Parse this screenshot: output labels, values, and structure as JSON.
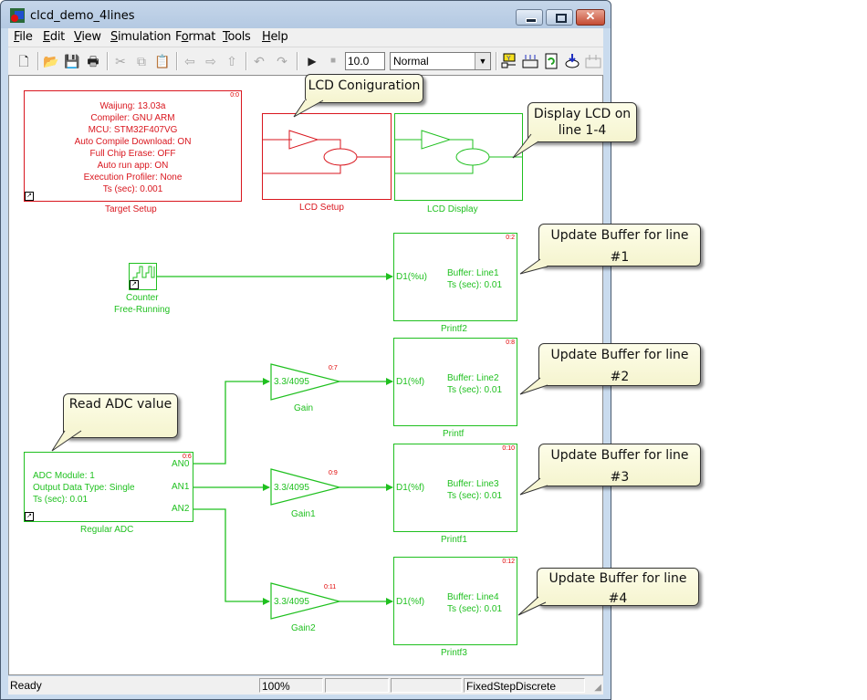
{
  "window": {
    "title": "clcd_demo_4lines",
    "controls": {
      "minimize": "minimize",
      "maximize": "maximize",
      "close": "close"
    }
  },
  "menubar": {
    "items": [
      {
        "label": "File",
        "mnemonic": "F"
      },
      {
        "label": "Edit",
        "mnemonic": "E"
      },
      {
        "label": "View",
        "mnemonic": "V"
      },
      {
        "label": "Simulation",
        "mnemonic": "S"
      },
      {
        "label": "Format",
        "mnemonic": "o"
      },
      {
        "label": "Tools",
        "mnemonic": "T"
      },
      {
        "label": "Help",
        "mnemonic": "H"
      }
    ]
  },
  "toolbar": {
    "icons": [
      "new-icon",
      "open-icon",
      "save-icon",
      "print-icon",
      "cut-icon",
      "copy-icon",
      "paste-icon",
      "back-icon",
      "forward-icon",
      "up-icon",
      "undo-icon",
      "redo-icon",
      "play-icon",
      "stop-icon",
      "library-browser-icon",
      "build-icon",
      "update-diagram-icon",
      "model-explorer-icon",
      "debug-icon"
    ],
    "stop_time": "10.0",
    "sim_mode": "Normal"
  },
  "diagram": {
    "target_setup": {
      "name": "Target Setup",
      "priority": "0:0",
      "lines": [
        "Waijung: 13.03a",
        "Compiler: GNU ARM",
        "MCU: STM32F407VG",
        "Auto Compile Download: ON",
        "Full Chip Erase: OFF",
        "Auto run app: ON",
        "Execution Profiler: None",
        "Ts (sec): 0.001"
      ]
    },
    "lcd_setup": {
      "name": "LCD Setup"
    },
    "lcd_display": {
      "name": "LCD Display"
    },
    "counter": {
      "name_line1": "Counter",
      "name_line2": "Free-Running"
    },
    "adc": {
      "name": "Regular ADC",
      "priority": "0:6",
      "lines": [
        "ADC Module: 1",
        "Output Data Type: Single",
        "Ts (sec): 0.01"
      ],
      "ports": [
        "AN0",
        "AN1",
        "AN2"
      ]
    },
    "gains": [
      {
        "name": "Gain",
        "value": "3.3/4095",
        "priority": "0:7"
      },
      {
        "name": "Gain1",
        "value": "3.3/4095",
        "priority": "0:9"
      },
      {
        "name": "Gain2",
        "value": "3.3/4095",
        "priority": "0:11"
      }
    ],
    "printfs": [
      {
        "name": "Printf2",
        "port": "D1(%u)",
        "buffer": "Buffer: Line1",
        "ts": "Ts (sec): 0.01",
        "priority": "0:2"
      },
      {
        "name": "Printf",
        "port": "D1(%f)",
        "buffer": "Buffer: Line2",
        "ts": "Ts (sec): 0.01",
        "priority": "0:8"
      },
      {
        "name": "Printf1",
        "port": "D1(%f)",
        "buffer": "Buffer: Line3",
        "ts": "Ts (sec): 0.01",
        "priority": "0:10"
      },
      {
        "name": "Printf3",
        "port": "D1(%f)",
        "buffer": "Buffer: Line4",
        "ts": "Ts (sec): 0.01",
        "priority": "0:12"
      }
    ],
    "callouts": {
      "lcd_config": "LCD Coniguration",
      "display_lcd": "Display LCD on line 1-4",
      "read_adc": "Read ADC value",
      "line1": "Update Buffer for line #1",
      "line2": "Update Buffer for line #2",
      "line3": "Update Buffer for line #3",
      "line4": "Update Buffer for line #4"
    },
    "colors": {
      "enabled_block": "#1fc01f",
      "target_block": "#d9161e",
      "priority": "#e00000"
    }
  },
  "statusbar": {
    "status": "Ready",
    "zoom": "100%",
    "solver": "FixedStepDiscrete"
  }
}
